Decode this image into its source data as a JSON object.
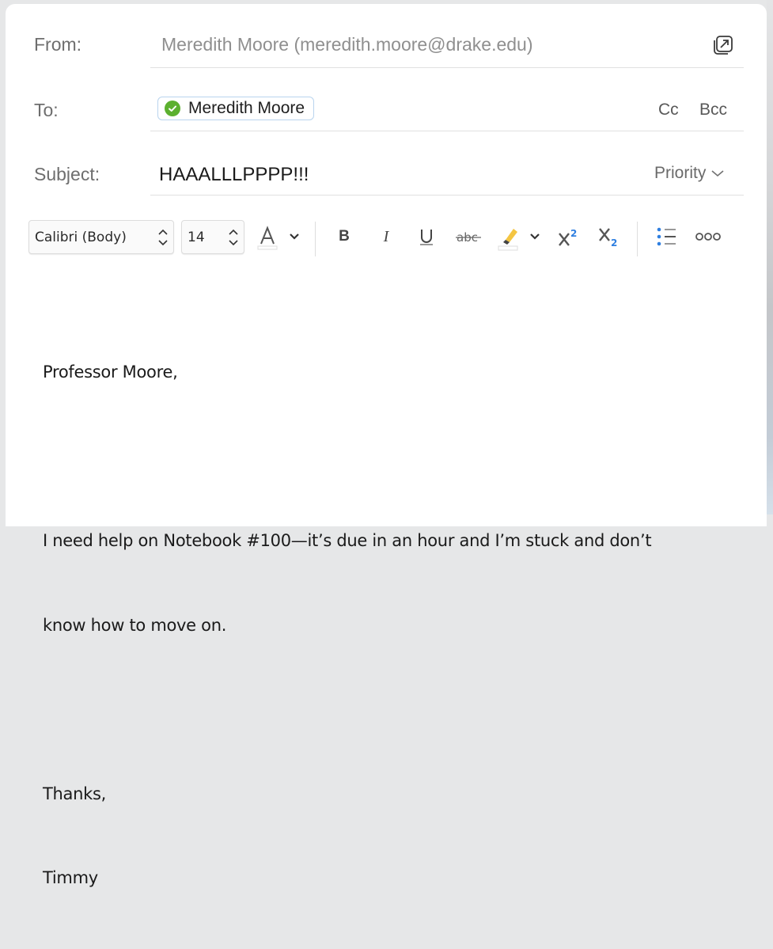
{
  "header": {
    "from_label": "From:",
    "from_value": "Meredith Moore (meredith.moore@drake.edu)",
    "popout_icon": "popout-window-icon",
    "to_label": "To:",
    "recipients": [
      {
        "name": "Meredith Moore",
        "status_icon": "verified-check-icon",
        "status_color": "#5cb02f"
      }
    ],
    "cc_label": "Cc",
    "bcc_label": "Bcc",
    "subject_label": "Subject:",
    "subject_value": "HAAALLLPPPP!!!",
    "priority_label": "Priority"
  },
  "toolbar": {
    "font_family": "Calibri (Body)",
    "font_size": "14",
    "font_color_icon": "font-color-icon",
    "bold_icon": "bold-icon",
    "italic_icon": "italic-icon",
    "underline_icon": "underline-icon",
    "strikethrough_icon": "strikethrough-icon",
    "highlight_icon": "highlight-icon",
    "highlight_color": "#f4c542",
    "superscript_icon": "superscript-icon",
    "subscript_icon": "subscript-icon",
    "bullet_list_icon": "bullet-list-icon",
    "more_icon": "more-options-icon",
    "accent_color": "#2f7fe0"
  },
  "body": {
    "lines": [
      "Professor Moore,",
      "",
      "I need help on Notebook #100—it’s due in an hour and I’m stuck and don’t",
      "know how to move on.",
      "",
      "Thanks,",
      "Timmy"
    ]
  }
}
